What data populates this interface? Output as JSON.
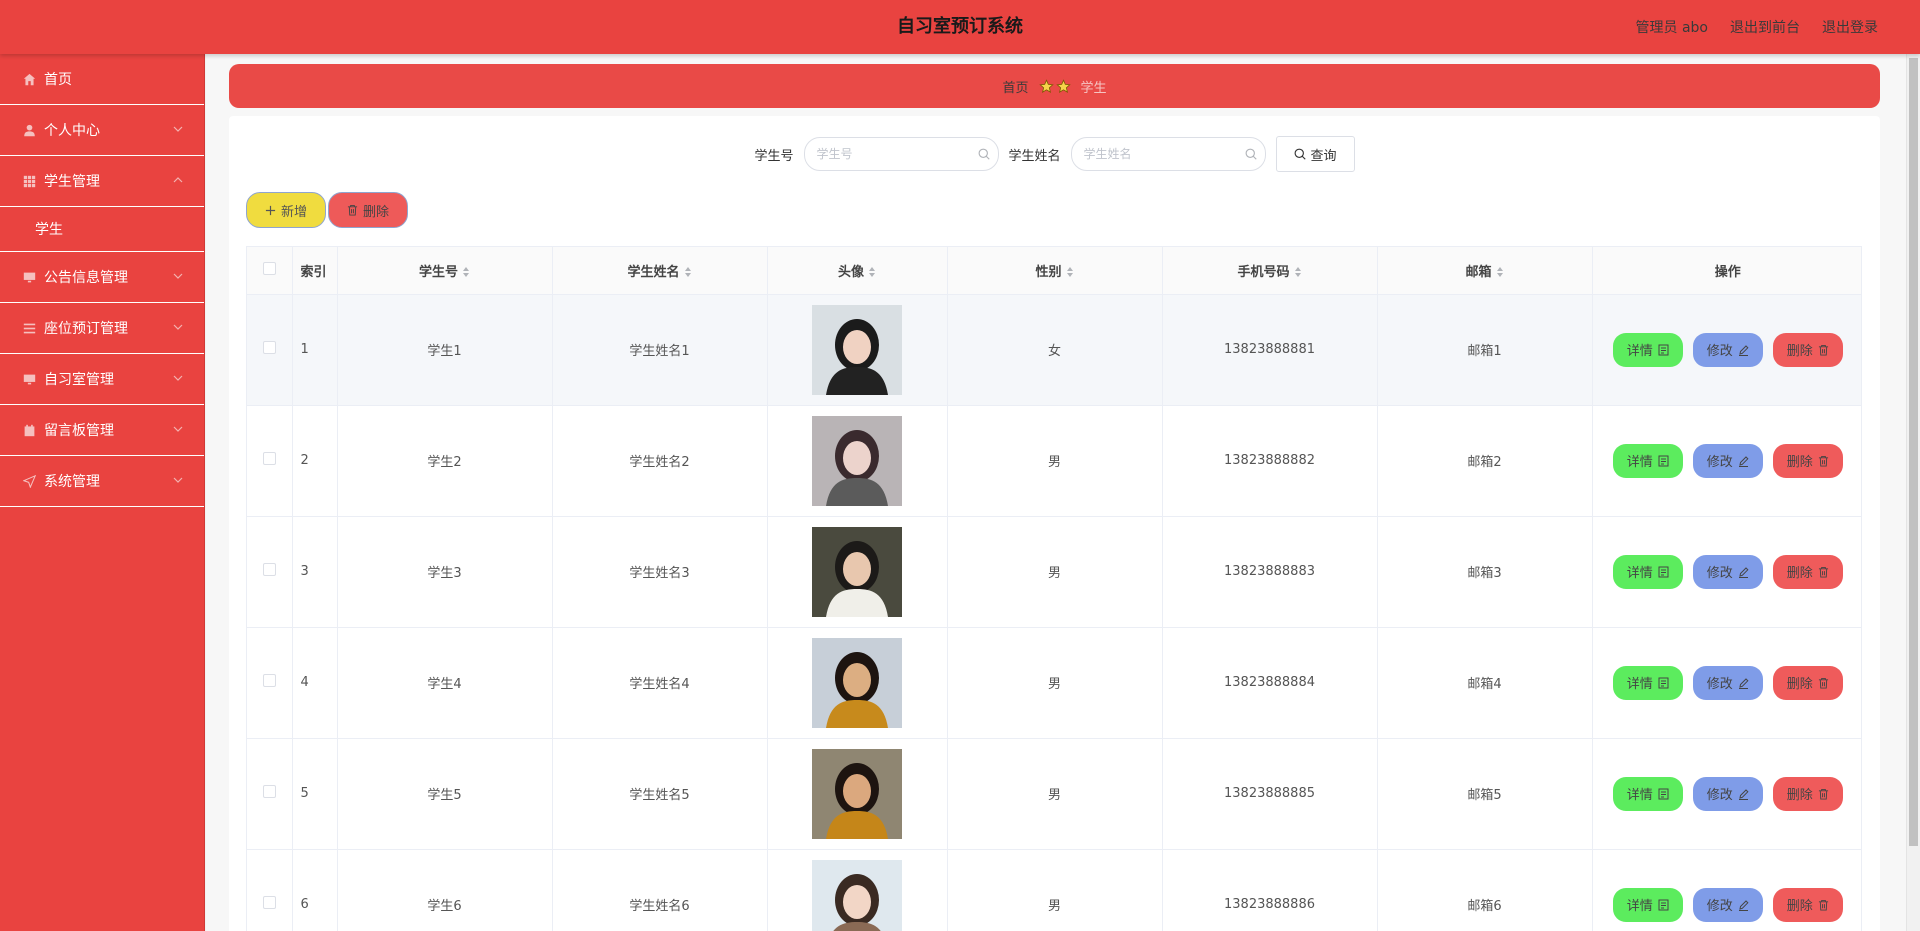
{
  "header": {
    "title": "自习室预订系统",
    "user": "管理员 abo",
    "back_front": "退出到前台",
    "logout": "退出登录"
  },
  "sidebar": {
    "items": [
      {
        "label": "首页",
        "icon": "home-icon"
      },
      {
        "label": "个人中心",
        "icon": "user-icon"
      },
      {
        "label": "学生管理",
        "icon": "grid-icon",
        "expanded": true,
        "children": [
          {
            "label": "学生"
          }
        ]
      },
      {
        "label": "公告信息管理",
        "icon": "monitor-icon"
      },
      {
        "label": "座位预订管理",
        "icon": "list-icon"
      },
      {
        "label": "自习室管理",
        "icon": "monitor-icon"
      },
      {
        "label": "留言板管理",
        "icon": "calendar-icon"
      },
      {
        "label": "系统管理",
        "icon": "send-icon"
      }
    ]
  },
  "breadcrumb": {
    "home": "首页",
    "current": "学生"
  },
  "search": {
    "student_no_label": "学生号",
    "student_no_placeholder": "学生号",
    "student_name_label": "学生姓名",
    "student_name_placeholder": "学生姓名",
    "query_label": "查询"
  },
  "toolbar": {
    "add_label": "新增",
    "delete_label": "删除"
  },
  "table": {
    "columns": [
      "索引",
      "学生号",
      "学生姓名",
      "头像",
      "性别",
      "手机号码",
      "邮箱",
      "操作"
    ],
    "rows": [
      {
        "index": "1",
        "student_no": "学生1",
        "name": "学生姓名1",
        "gender": "女",
        "phone": "13823888881",
        "email": "邮箱1"
      },
      {
        "index": "2",
        "student_no": "学生2",
        "name": "学生姓名2",
        "gender": "男",
        "phone": "13823888882",
        "email": "邮箱2"
      },
      {
        "index": "3",
        "student_no": "学生3",
        "name": "学生姓名3",
        "gender": "男",
        "phone": "13823888883",
        "email": "邮箱3"
      },
      {
        "index": "4",
        "student_no": "学生4",
        "name": "学生姓名4",
        "gender": "男",
        "phone": "13823888884",
        "email": "邮箱4"
      },
      {
        "index": "5",
        "student_no": "学生5",
        "name": "学生姓名5",
        "gender": "男",
        "phone": "13823888885",
        "email": "邮箱5"
      },
      {
        "index": "6",
        "student_no": "学生6",
        "name": "学生姓名6",
        "gender": "男",
        "phone": "13823888886",
        "email": "邮箱6"
      }
    ],
    "actions": {
      "detail": "详情",
      "edit": "修改",
      "delete": "删除"
    }
  },
  "colors": {
    "brand": "#e94340",
    "add_button": "#f0dc3f",
    "detail_button": "#5cec5e",
    "edit_button": "#7f9ce8",
    "delete_button": "#ef5b5b"
  }
}
